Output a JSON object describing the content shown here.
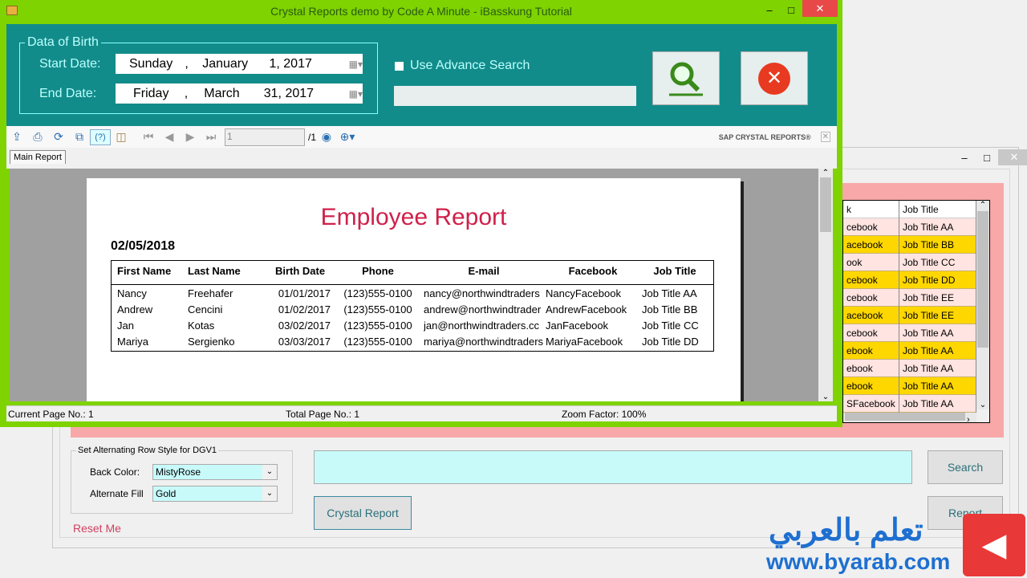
{
  "front_window": {
    "title": "Crystal Reports demo by Code A Minute - iBasskung Tutorial",
    "dob_group": "Data of Birth",
    "start_label": "Start Date:",
    "end_label": "End Date:",
    "start_date": {
      "weekday": "Sunday",
      "month": "January",
      "day_year": "1, 2017"
    },
    "end_date": {
      "weekday": "Friday",
      "month": "March",
      "day_year": "31, 2017"
    },
    "advance_search_label": "Use Advance Search",
    "advance_search_checked": false,
    "advance_search_value": ""
  },
  "viewer": {
    "page_input": "1",
    "page_total": "/1",
    "brand": "SAP CRYSTAL REPORTS®",
    "tab": "Main Report",
    "status": {
      "current": "Current Page No.: 1",
      "total": "Total Page No.: 1",
      "zoom": "Zoom Factor: 100%"
    }
  },
  "report": {
    "title": "Employee Report",
    "date": "02/05/2018",
    "columns": [
      "First Name",
      "Last Name",
      "Birth Date",
      "Phone",
      "E-mail",
      "Facebook",
      "Job Title"
    ],
    "rows": [
      [
        "Nancy",
        "Freehafer",
        "01/01/2017",
        "(123)555-0100",
        "nancy@northwindtraders",
        "NancyFacebook",
        "Job Title AA"
      ],
      [
        "Andrew",
        "Cencini",
        "01/02/2017",
        "(123)555-0100",
        "andrew@northwindtrader",
        "AndrewFacebook",
        "Job Title BB"
      ],
      [
        "Jan",
        "Kotas",
        "03/02/2017",
        "(123)555-0100",
        "jan@northwindtraders.cc",
        "JanFacebook",
        "Job Title CC"
      ],
      [
        "Mariya",
        "Sergienko",
        "03/03/2017",
        "(123)555-0100",
        "mariya@northwindtraders",
        "MariyaFacebook",
        "Job Title DD"
      ]
    ]
  },
  "back_window": {
    "grid": {
      "columns": [
        "k",
        "Job Title"
      ],
      "rows": [
        [
          "cebook",
          "Job Title AA"
        ],
        [
          "acebook",
          "Job Title BB"
        ],
        [
          "ook",
          "Job Title CC"
        ],
        [
          "cebook",
          "Job Title DD"
        ],
        [
          "cebook",
          "Job Title EE"
        ],
        [
          "acebook",
          "Job Title EE"
        ],
        [
          "cebook",
          "Job Title AA"
        ],
        [
          "ebook",
          "Job Title AA"
        ],
        [
          "ebook",
          "Job Title AA"
        ],
        [
          "ebook",
          "Job Title AA"
        ],
        [
          "SFacebook",
          "Job Title AA"
        ]
      ]
    },
    "row_style_group": "Set Alternating Row Style for DGV1",
    "back_color_label": "Back Color:",
    "back_color_value": "MistyRose",
    "alt_fill_label": "Alternate Fill",
    "alt_fill_value": "Gold",
    "reset_label": "Reset Me",
    "search_value": "",
    "search_button": "Search",
    "crystal_button": "Crystal Report",
    "report_button": "Report"
  },
  "watermark": {
    "arabic": "تعلم بالعربي",
    "url": "www.byarab.com"
  },
  "colors": {
    "title_bar": "#7ed300",
    "panel": "#128c8a",
    "report_title": "#d0204a",
    "row_base": "#ffe4e1",
    "row_alt": "#ffd700"
  }
}
